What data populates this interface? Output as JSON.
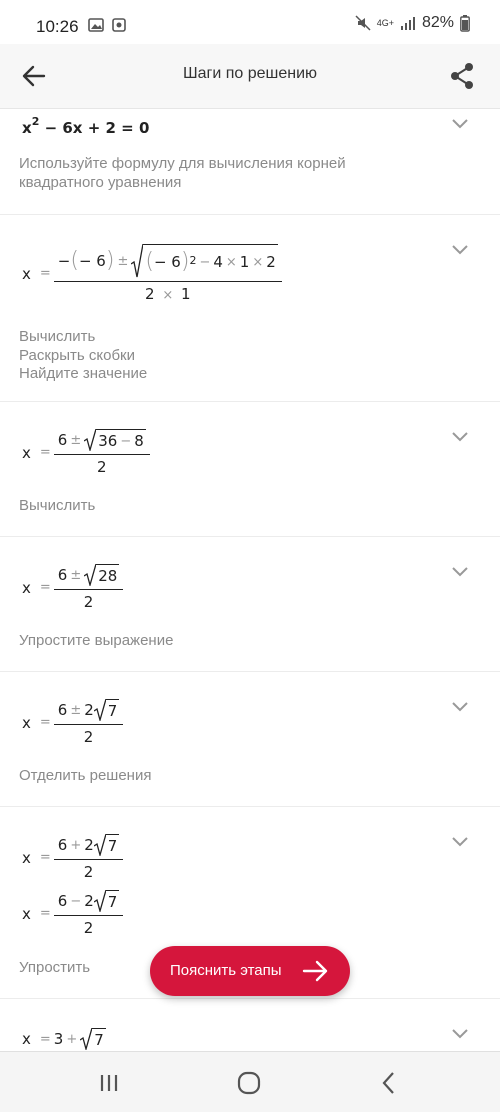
{
  "status": {
    "time": "10:26",
    "battery": "82%",
    "network": "4G+"
  },
  "appbar": {
    "title": "Шаги по решению"
  },
  "steps": [
    {
      "equation": {
        "lhs": "x",
        "exp": "2",
        "rest": "− 6x + 2 = 0"
      },
      "description_lines": [
        "Используйте формулу для вычисления корней",
        "квадратного уравнения"
      ]
    },
    {
      "description_lines": [
        "Вычислить",
        "Раскрыть скобки",
        "Найдите значение"
      ]
    },
    {
      "description_lines": [
        "Вычислить"
      ]
    },
    {
      "description_lines": [
        "Упростите выражение"
      ]
    },
    {
      "description_lines": [
        "Отделить решения"
      ]
    },
    {
      "description_lines": [
        "Упростить"
      ]
    }
  ],
  "math": {
    "x": "x",
    "eq": "=",
    "minus": "−",
    "pm": "±",
    "plus": "+",
    "times": "×",
    "six": "6",
    "neg6": "− 6",
    "two": "2",
    "four": "4",
    "one": "1",
    "thirtysix": "36",
    "eight": "8",
    "twentyeight": "28",
    "seven": "7",
    "three": "3"
  },
  "fab": {
    "label": "Пояснить этапы"
  }
}
